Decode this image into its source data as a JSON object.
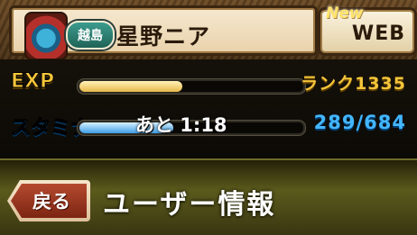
{
  "header": {
    "region_badge": "越島",
    "player_name": "星野ニア",
    "new_badge": "New",
    "web_label": "WEB"
  },
  "exp": {
    "label": "EXP",
    "progress_percent": 46,
    "rank_text": "ランク1335"
  },
  "stamina": {
    "label": "スタミナ",
    "progress_percent": 42,
    "remaining_text": "あと 1:18",
    "value_text": "289/684"
  },
  "page": {
    "back_label": "戻る",
    "title": "ユーザー情報"
  },
  "colors": {
    "exp_accent": "#f5c53a",
    "stamina_accent": "#43b6ff",
    "header_band": "#5b5a1c"
  },
  "icons": {
    "monster": "monster-avatar-icon"
  }
}
